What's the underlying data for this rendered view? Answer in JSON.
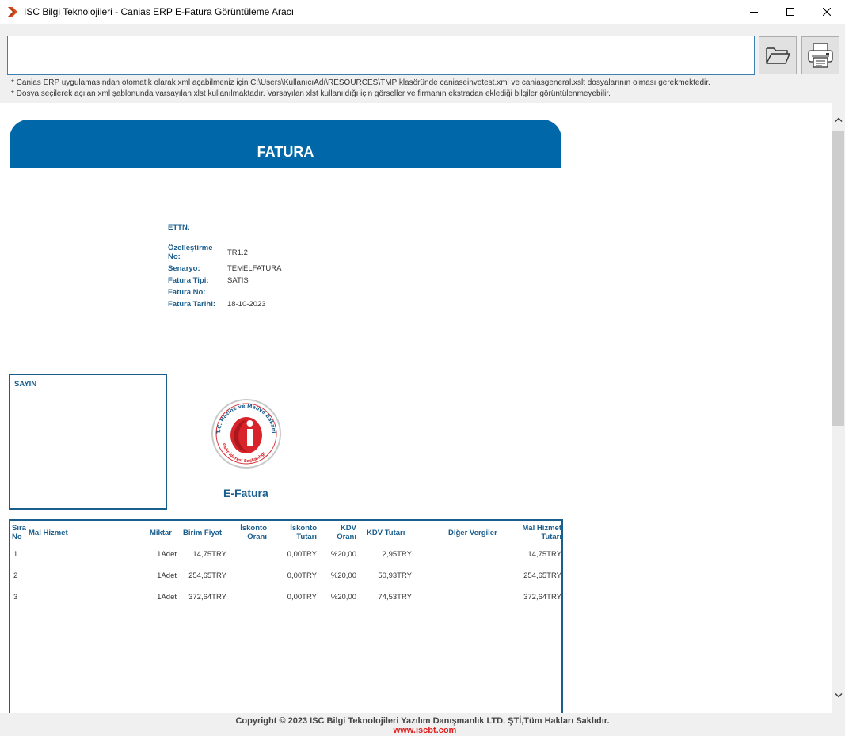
{
  "window": {
    "title": "ISC Bilgi Teknolojileri - Canias ERP E-Fatura Görüntüleme Aracı",
    "icon": "isc-chevron-icon",
    "controls": [
      "minimize-icon",
      "maximize-icon",
      "close-icon"
    ]
  },
  "toolbar": {
    "path_value": "",
    "open_icon": "folder-open-icon",
    "print_icon": "printer-icon"
  },
  "notes": [
    "* Canias ERP uygulamasından otomatik olarak xml açabilmeniz için C:\\Users\\KullanıcıAdı\\RESOURCES\\TMP klasöründe caniaseinvotest.xml ve caniasgeneral.xslt dosyalarının olması gerekmektedir.",
    "* Dosya seçilerek açılan xml şablonunda varsayılan xlst kullanılmaktadır. Varsayılan xlst kullanıldığı için görseller ve firmanın ekstradan eklediği bilgiler görüntülenmeyebilir."
  ],
  "invoice": {
    "banner": "FATURA",
    "info": [
      {
        "label": "ETTN:",
        "value": ""
      },
      {
        "label": "Özelleştirme\nNo:",
        "value": "TR1.2"
      },
      {
        "label": "Senaryo:",
        "value": "TEMELFATURA"
      },
      {
        "label": "Fatura Tipi:",
        "value": "SATIS"
      },
      {
        "label": "Fatura No:",
        "value": ""
      },
      {
        "label": "Fatura Tarihi:",
        "value": "18-10-2023"
      }
    ],
    "recipient_label": "SAYIN",
    "logo_text_top": "T.C. Hazine ve Maliye Bakanlığı",
    "logo_text_bottom": "Gelir İdaresi Başkanlığı",
    "efatura_label": "E-Fatura",
    "table": {
      "headers": {
        "sira": "Sıra\nNo",
        "mal_hizmet": "Mal Hizmet",
        "miktar": "Miktar",
        "birim_fiyat": "Birim Fiyat",
        "iskonto_orani": "İskonto\nOranı",
        "iskonto_tutari": "İskonto\nTutarı",
        "kdv_orani": "KDV\nOranı",
        "kdv_tutari": "KDV Tutarı",
        "diger_vergiler": "Diğer Vergiler",
        "mal_hizmet_tutari": "Mal Hizmet\nTutarı"
      },
      "rows": [
        {
          "sira": "1",
          "miktar": "1Adet",
          "birim_fiyat": "14,75TRY",
          "iskonto_tutari": "0,00TRY",
          "kdv_orani": "%20,00",
          "kdv_tutari": "2,95TRY",
          "tutar": "14,75TRY"
        },
        {
          "sira": "2",
          "miktar": "1Adet",
          "birim_fiyat": "254,65TRY",
          "iskonto_tutari": "0,00TRY",
          "kdv_orani": "%20,00",
          "kdv_tutari": "50,93TRY",
          "tutar": "254,65TRY"
        },
        {
          "sira": "3",
          "miktar": "1Adet",
          "birim_fiyat": "372,64TRY",
          "iskonto_tutari": "0,00TRY",
          "kdv_orani": "%20,00",
          "kdv_tutari": "74,53TRY",
          "tutar": "372,64TRY"
        }
      ]
    }
  },
  "footer": {
    "copyright": "Copyright © 2023 ISC Bilgi Teknolojileri Yazılım Danışmanlık LTD. ŞTİ,Tüm Hakları Saklıdır.",
    "website": "www.iscbt.com"
  },
  "colors": {
    "brand_blue": "#0068a8",
    "label_blue": "#1a5e8e",
    "link_red": "#e02020",
    "logo_red": "#d8232a"
  }
}
